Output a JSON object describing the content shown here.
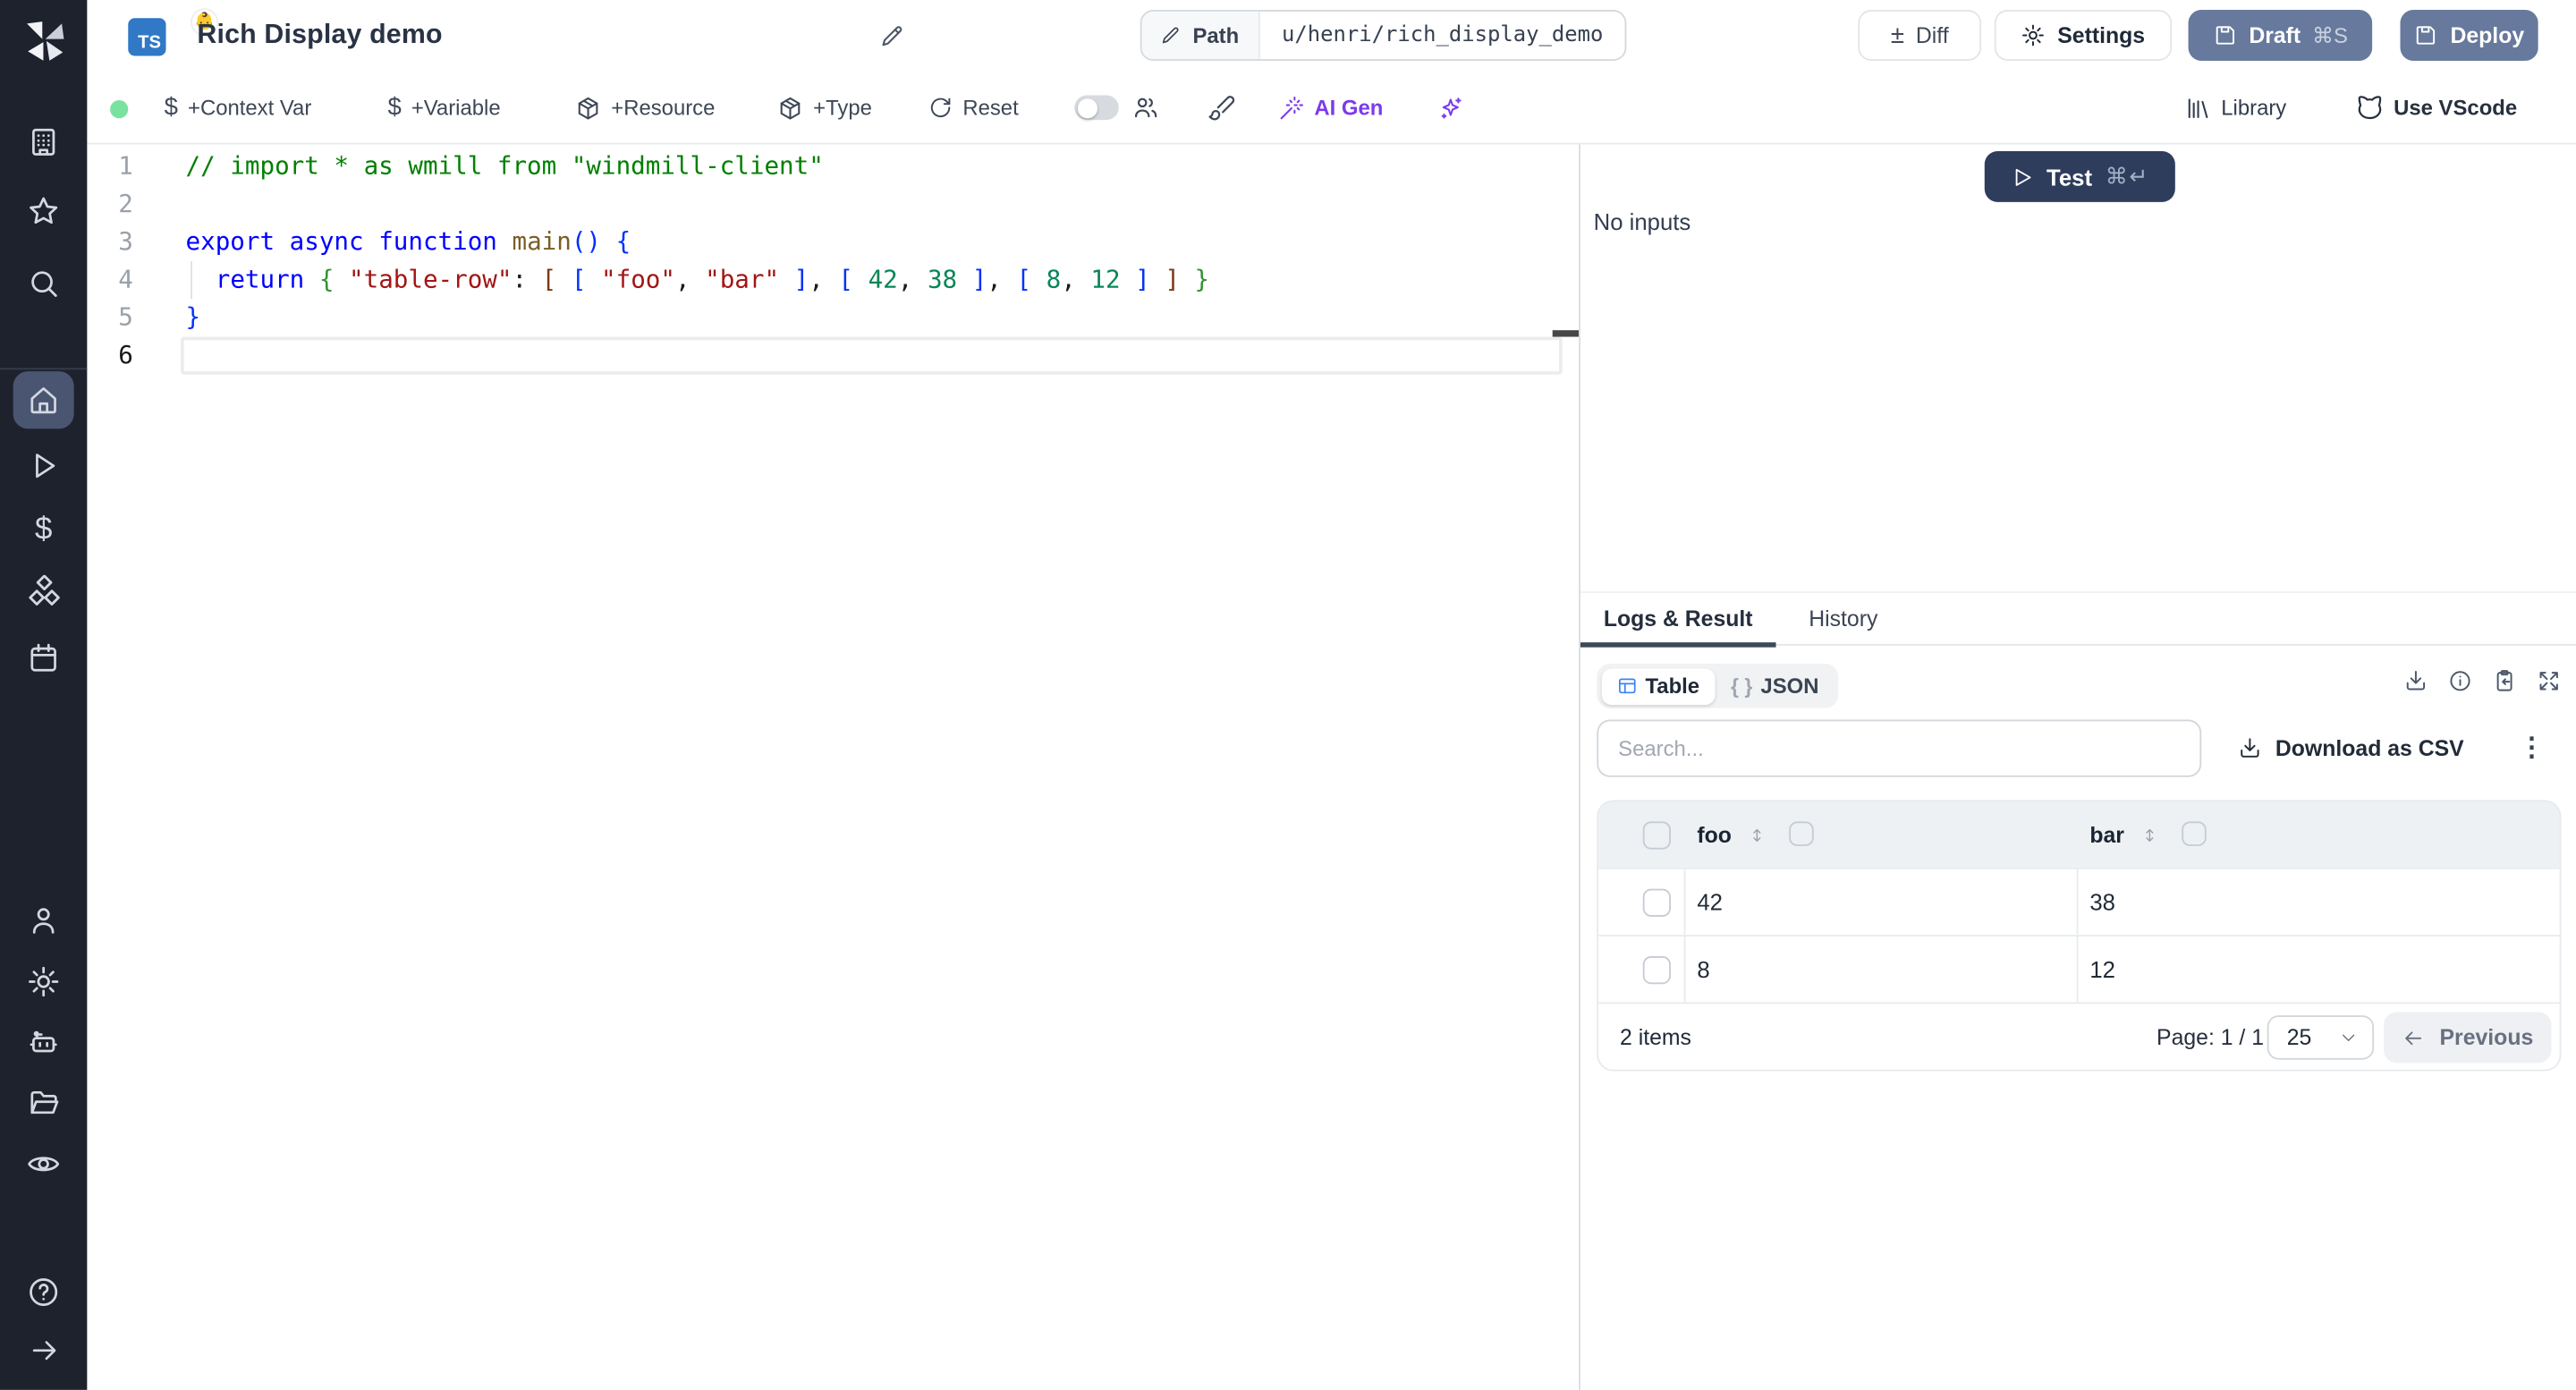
{
  "colors": {
    "sidebar_bg": "#1d222d",
    "sidebar_active_tile": "#4a5571",
    "ts_badge_blue": "#3178c6",
    "primary_button_blue": "#67799c",
    "test_button_navy": "#2f3d5c",
    "ai_accent_purple": "#7c3aed",
    "status_green_dot": "#7ae2a0",
    "table_icon_blue": "#3b82f6",
    "code_comment": "#008000",
    "code_keyword": "#0000ff",
    "code_string": "#a31515",
    "code_number": "#098658",
    "code_bracket_1": "#0431fa",
    "code_bracket_2": "#319331",
    "code_bracket_3": "#7b3814"
  },
  "sidebar": {
    "active_item": "home",
    "items": [
      "workspace",
      "favorites",
      "search",
      "home",
      "runs",
      "variables",
      "resources",
      "schedules",
      "user",
      "settings",
      "workers",
      "folders",
      "audit-logs",
      "help",
      "expand"
    ]
  },
  "header": {
    "language_badge": "TS",
    "emoji_badge": "👶",
    "title": "Rich Display demo",
    "path_label": "Path",
    "path_value": "u/henri/rich_display_demo",
    "diff_label": "Diff",
    "settings_label": "Settings",
    "draft_label": "Draft",
    "draft_shortcut": "⌘S",
    "deploy_label": "Deploy"
  },
  "toolbar": {
    "context_var_label": "+Context Var",
    "variable_label": "+Variable",
    "resource_label": "+Resource",
    "type_label": "+Type",
    "reset_label": "Reset",
    "ai_gen_label": "AI Gen",
    "library_label": "Library",
    "vscode_label": "Use VScode"
  },
  "editor": {
    "lines": [
      {
        "num": "1",
        "tokens": [
          {
            "t": "// import * as wmill from \"windmill-client\"",
            "c": "cm"
          }
        ]
      },
      {
        "num": "2",
        "tokens": []
      },
      {
        "num": "3",
        "tokens": [
          {
            "t": "export",
            "c": "kw"
          },
          {
            "t": " ",
            "c": "pl"
          },
          {
            "t": "async",
            "c": "kw"
          },
          {
            "t": " ",
            "c": "pl"
          },
          {
            "t": "function",
            "c": "kw"
          },
          {
            "t": " ",
            "c": "pl"
          },
          {
            "t": "main",
            "c": "fn"
          },
          {
            "t": "()",
            "c": "b1"
          },
          {
            "t": " ",
            "c": "pl"
          },
          {
            "t": "{",
            "c": "b1"
          }
        ]
      },
      {
        "num": "4",
        "tokens": [
          {
            "t": "  ",
            "c": "pl"
          },
          {
            "t": "return",
            "c": "kw"
          },
          {
            "t": " ",
            "c": "pl"
          },
          {
            "t": "{",
            "c": "b2"
          },
          {
            "t": " ",
            "c": "pl"
          },
          {
            "t": "\"table-row\"",
            "c": "str"
          },
          {
            "t": ": ",
            "c": "pl"
          },
          {
            "t": "[",
            "c": "b3"
          },
          {
            "t": " ",
            "c": "pl"
          },
          {
            "t": "[",
            "c": "b4"
          },
          {
            "t": " ",
            "c": "pl"
          },
          {
            "t": "\"foo\"",
            "c": "str"
          },
          {
            "t": ", ",
            "c": "pl"
          },
          {
            "t": "\"bar\"",
            "c": "str"
          },
          {
            "t": " ",
            "c": "pl"
          },
          {
            "t": "]",
            "c": "b4"
          },
          {
            "t": ", ",
            "c": "pl"
          },
          {
            "t": "[",
            "c": "b4"
          },
          {
            "t": " ",
            "c": "pl"
          },
          {
            "t": "42",
            "c": "num"
          },
          {
            "t": ", ",
            "c": "pl"
          },
          {
            "t": "38",
            "c": "num"
          },
          {
            "t": " ",
            "c": "pl"
          },
          {
            "t": "]",
            "c": "b4"
          },
          {
            "t": ", ",
            "c": "pl"
          },
          {
            "t": "[",
            "c": "b4"
          },
          {
            "t": " ",
            "c": "pl"
          },
          {
            "t": "8",
            "c": "num"
          },
          {
            "t": ", ",
            "c": "pl"
          },
          {
            "t": "12",
            "c": "num"
          },
          {
            "t": " ",
            "c": "pl"
          },
          {
            "t": "]",
            "c": "b4"
          },
          {
            "t": " ",
            "c": "pl"
          },
          {
            "t": "]",
            "c": "b3"
          },
          {
            "t": " ",
            "c": "pl"
          },
          {
            "t": "}",
            "c": "b2"
          }
        ]
      },
      {
        "num": "5",
        "tokens": [
          {
            "t": "}",
            "c": "b1"
          }
        ]
      },
      {
        "num": "6",
        "active": true,
        "tokens": []
      }
    ]
  },
  "run_panel": {
    "test_label": "Test",
    "test_shortcut": "⌘↵",
    "no_inputs": "No inputs"
  },
  "results": {
    "tabs": [
      "Logs & Result",
      "History"
    ],
    "active_tab": "Logs & Result",
    "view_toggle": {
      "table_label": "Table",
      "json_label": "JSON",
      "json_icon": "{ }"
    },
    "search_placeholder": "Search...",
    "download_csv_label": "Download as CSV",
    "table": {
      "columns": [
        "foo",
        "bar"
      ],
      "rows": [
        [
          "42",
          "38"
        ],
        [
          "8",
          "12"
        ]
      ],
      "items_count": "2 items",
      "page_label": "Page: 1 / 1",
      "page_size": "25",
      "prev_label": "Previous"
    }
  }
}
